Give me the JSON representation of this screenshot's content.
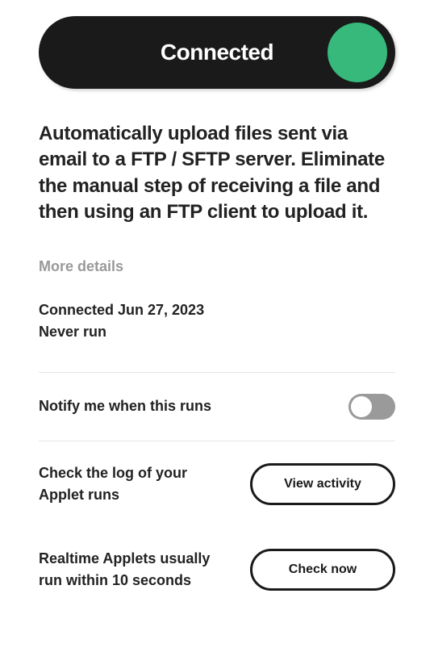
{
  "status": {
    "label": "Connected",
    "dot_color": "#36b97a"
  },
  "description": "Automatically upload files sent via email to a FTP / SFTP server. Eliminate the manual step of receiving a file and then using an FTP client to upload it.",
  "more_details_label": "More details",
  "meta": {
    "connected": "Connected Jun 27, 2023",
    "last_run": "Never run"
  },
  "notify": {
    "label": "Notify me when this runs",
    "enabled": false
  },
  "activity": {
    "label": "Check the log of your Applet runs",
    "button": "View activity"
  },
  "check": {
    "label": "Realtime Applets usually run within 10 seconds",
    "button": "Check now"
  }
}
